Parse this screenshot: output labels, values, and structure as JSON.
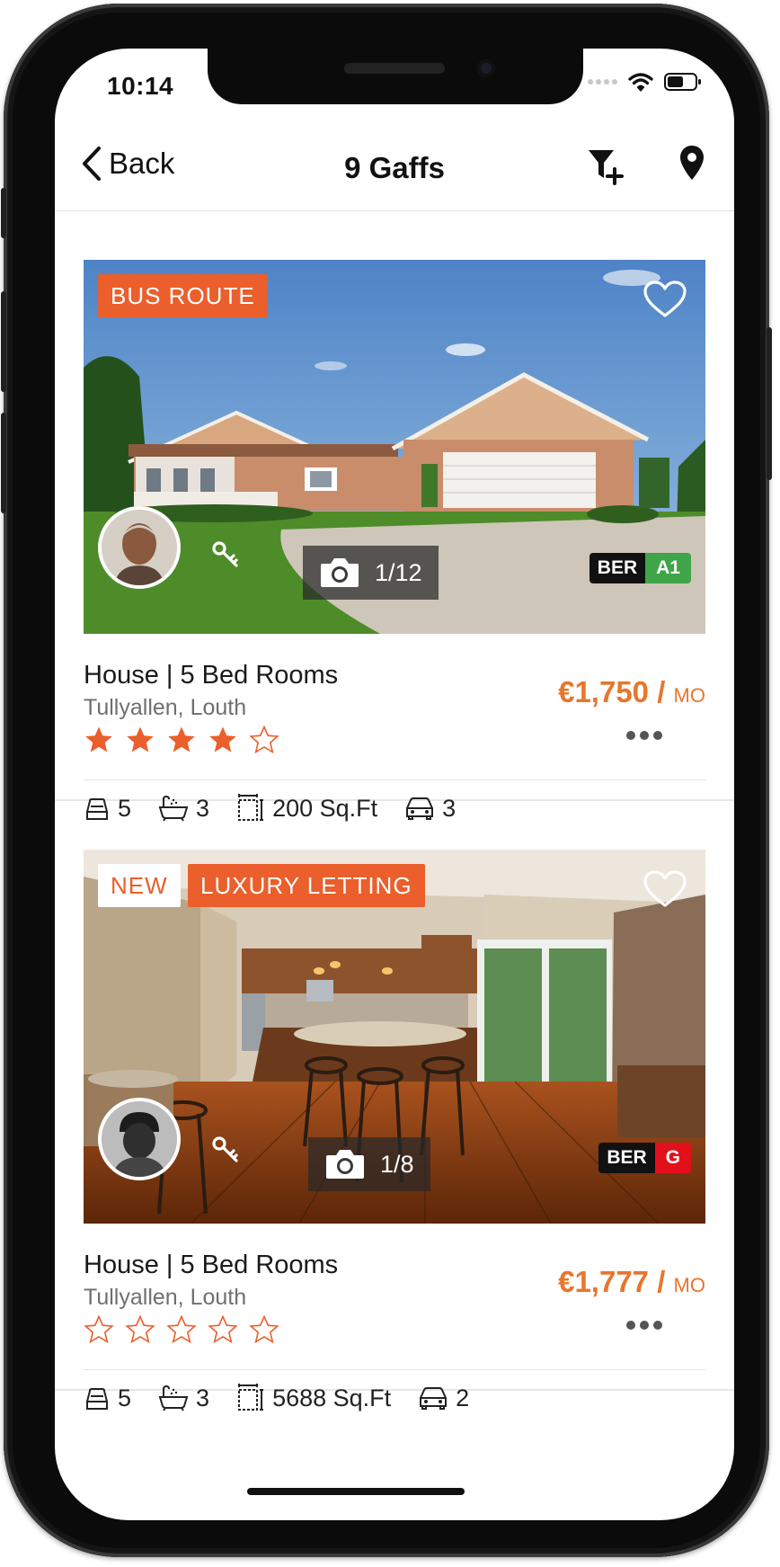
{
  "status_bar": {
    "time": "10:14"
  },
  "nav": {
    "back_label": "Back",
    "title": "9 Gaffs"
  },
  "colors": {
    "accent": "#ea5f2b",
    "price": "#e8762d",
    "ber_green": "#3fa548",
    "ber_red": "#e3101c"
  },
  "listings": [
    {
      "tags": [
        "BUS ROUTE"
      ],
      "photo_count": "1/12",
      "ber_label": "BER",
      "ber_rating": "A1",
      "ber_color": "#3fa548",
      "title": "House | 5 Bed Rooms",
      "location": "Tullyallen, Louth",
      "price": "€1,750 /",
      "price_unit": "MO",
      "rating": 4,
      "rating_max": 5,
      "features": {
        "bedrooms": "5",
        "bathrooms": "3",
        "area": "200 Sq.Ft",
        "parking": "3"
      }
    },
    {
      "tags": [
        "NEW",
        "LUXURY LETTING"
      ],
      "photo_count": "1/8",
      "ber_label": "BER",
      "ber_rating": "G",
      "ber_color": "#e3101c",
      "title": "House | 5 Bed Rooms",
      "location": "Tullyallen, Louth",
      "price": "€1,777 /",
      "price_unit": "MO",
      "rating": 0,
      "rating_max": 5,
      "features": {
        "bedrooms": "5",
        "bathrooms": "3",
        "area": "5688 Sq.Ft",
        "parking": "2"
      }
    }
  ],
  "icons": [
    "back-chevron-icon",
    "filter-add-icon",
    "location-pin-icon",
    "heart-icon",
    "key-icon",
    "camera-icon",
    "bed-icon",
    "bathtub-icon",
    "area-icon",
    "car-icon",
    "star-icon"
  ]
}
